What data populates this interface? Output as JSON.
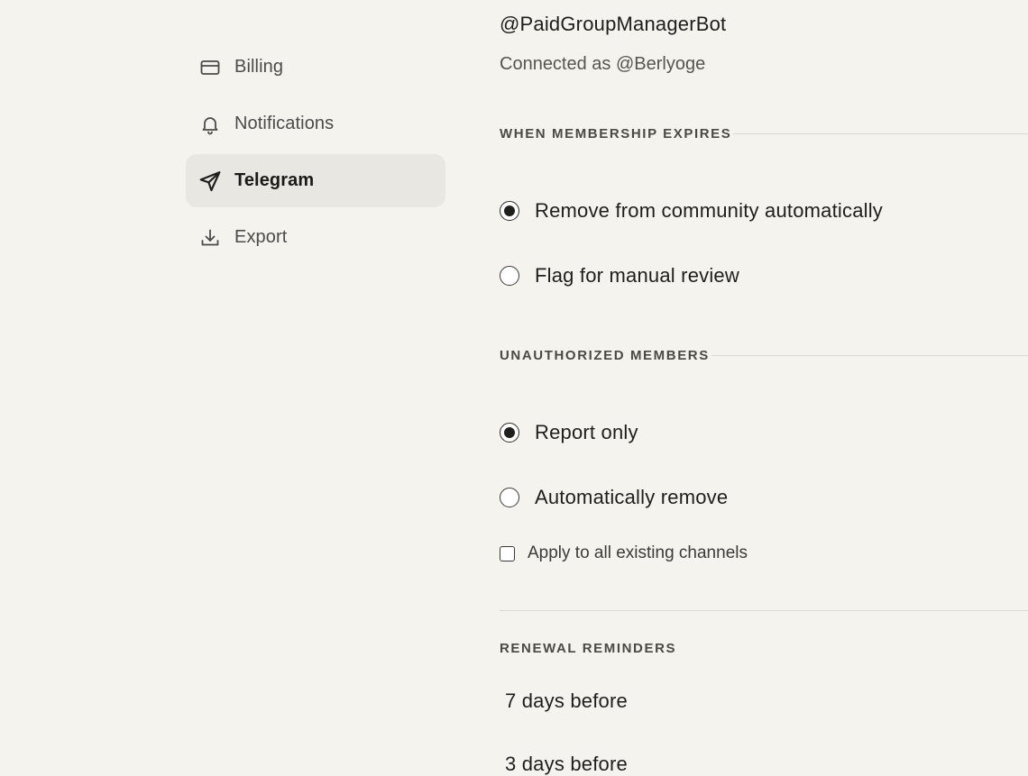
{
  "sidebar": {
    "items": [
      {
        "label": "Billing",
        "icon": "credit-card-icon",
        "active": false
      },
      {
        "label": "Notifications",
        "icon": "bell-icon",
        "active": false
      },
      {
        "label": "Telegram",
        "icon": "send-icon",
        "active": true
      },
      {
        "label": "Export",
        "icon": "download-icon",
        "active": false
      }
    ]
  },
  "main": {
    "bot_name": "@PaidGroupManagerBot",
    "connected_as": "Connected as @Berlyoge",
    "membership_expires": {
      "heading": "WHEN MEMBERSHIP EXPIRES",
      "options": [
        {
          "label": "Remove from community automatically",
          "selected": true
        },
        {
          "label": "Flag for manual review",
          "selected": false
        }
      ]
    },
    "unauthorized_members": {
      "heading": "UNAUTHORIZED MEMBERS",
      "options": [
        {
          "label": "Report only",
          "selected": true
        },
        {
          "label": "Automatically remove",
          "selected": false
        }
      ],
      "apply_all": {
        "label": "Apply to all existing channels",
        "checked": false
      }
    },
    "renewal_reminders": {
      "heading": "RENEWAL REMINDERS",
      "items": [
        "7 days before",
        "3 days before"
      ]
    }
  },
  "colors": {
    "background": "#f4f3ee",
    "active_nav": "#e8e7e1",
    "text": "#1f1f1c",
    "muted_text": "#4b4b47",
    "rule": "#d9d8d2"
  }
}
